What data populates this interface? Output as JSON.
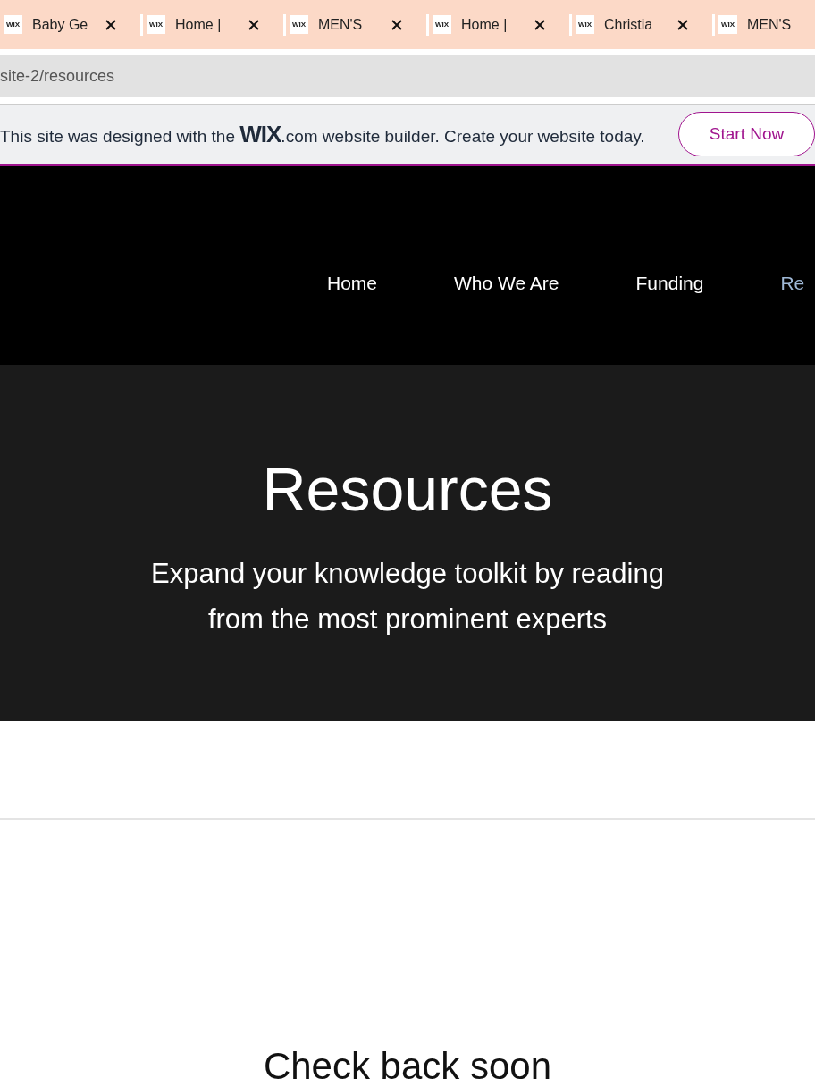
{
  "tabs": [
    {
      "favicon": "WIX",
      "title": "Baby Ge",
      "closable": true
    },
    {
      "favicon": "WIX",
      "title": "Home |",
      "closable": true
    },
    {
      "favicon": "WIX",
      "title": "MEN'S",
      "closable": true
    },
    {
      "favicon": "WIX",
      "title": "Home |",
      "closable": true
    },
    {
      "favicon": "WIX",
      "title": "Christia",
      "closable": true
    },
    {
      "favicon": "WIX",
      "title": "MEN'S",
      "closable": false
    }
  ],
  "address_bar": {
    "url": "site-2/resources"
  },
  "wix_banner": {
    "text_before": "This site was designed with the",
    "logo": "WIX",
    "text_after": ".com website builder. Create your website today.",
    "button": "Start Now"
  },
  "nav": [
    {
      "label": "Home",
      "selected": false
    },
    {
      "label": "Who We Are",
      "selected": false
    },
    {
      "label": "Funding",
      "selected": false
    },
    {
      "label": "Re",
      "selected": true
    }
  ],
  "hero": {
    "title": "Resources",
    "subtitle": "Expand your knowledge toolkit by reading from the most prominent experts"
  },
  "content": {
    "heading": "Check back soon"
  }
}
